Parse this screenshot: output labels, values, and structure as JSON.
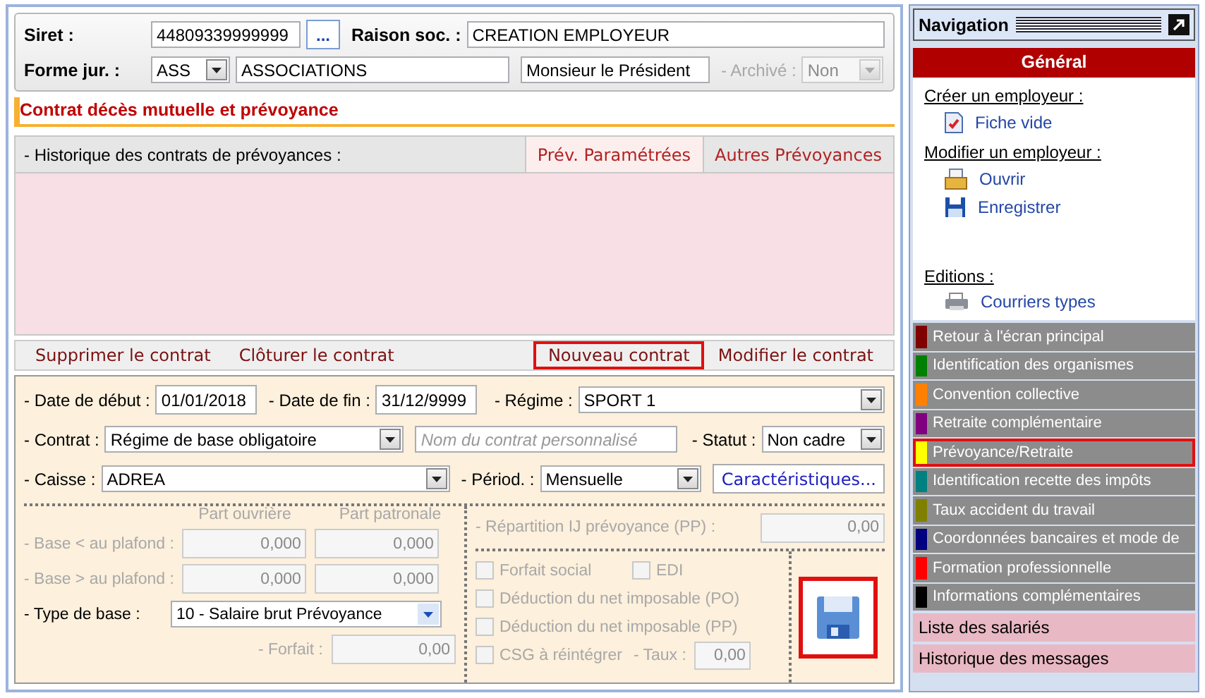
{
  "employer": {
    "siret_label": "Siret :",
    "siret": "44809339999999",
    "browse": "...",
    "name_label": "Raison soc. :",
    "name": "CREATION EMPLOYEUR",
    "form_label": "Forme jur. :",
    "form_code": "ASS",
    "form_name": "ASSOCIATIONS",
    "representative": "Monsieur le Président",
    "archive_label": "- Archivé :",
    "archive": "Non",
    "archive_disabled": true
  },
  "section_title": "Contrat décès mutuelle et prévoyance",
  "history": {
    "label": "- Historique des contrats de prévoyances :",
    "tabs": [
      {
        "label": "Prév. Paramétrées",
        "selected": true
      },
      {
        "label": "Autres Prévoyances",
        "selected": false
      }
    ]
  },
  "actions": [
    {
      "label": "Supprimer le contrat",
      "highlighted": false
    },
    {
      "label": "Clôturer le contrat",
      "highlighted": false
    },
    {
      "label": "Nouveau contrat",
      "highlighted": true
    },
    {
      "label": "Modifier le contrat",
      "highlighted": false
    }
  ],
  "contract": {
    "date_start": {
      "label": "- Date de début :",
      "value": "01/01/2018"
    },
    "date_end": {
      "label": "- Date de fin :",
      "value": "31/12/9999"
    },
    "regime": {
      "label": "- Régime :",
      "value": "SPORT 1"
    },
    "contract": {
      "label": "- Contrat :",
      "value": "Régime de base obligatoire"
    },
    "custom_name": {
      "placeholder": "Nom du contrat personnalisé"
    },
    "status": {
      "label": "- Statut :",
      "value": "Non cadre"
    },
    "fund": {
      "label": "- Caisse :",
      "value": "ADREA"
    },
    "period": {
      "label": "- Périod. :",
      "value": "Mensuelle"
    },
    "characteristics": "Caractéristiques..."
  },
  "bases": {
    "columns": [
      "Part ouvrière",
      "Part patronale"
    ],
    "rows": [
      {
        "label": "- Base < au plafond :",
        "values": [
          "0,000",
          "0,000"
        ],
        "disabled": true
      },
      {
        "label": "- Base > au plafond :",
        "values": [
          "0,000",
          "0,000"
        ],
        "disabled": true
      }
    ],
    "base_type": {
      "label": "- Type de base :",
      "value": "10 - Salaire brut Prévoyance",
      "disabled": false
    },
    "flat": {
      "label": "- Forfait :",
      "value": "0,00",
      "disabled": true
    }
  },
  "options": {
    "split": {
      "label": "- Répartition IJ prévoyance (PP) :",
      "value": "0,00",
      "disabled": true
    },
    "checkboxes": [
      {
        "label": "Forfait social",
        "checked": false,
        "disabled": true
      },
      {
        "label": "EDI",
        "checked": false,
        "disabled": true
      },
      {
        "label": "Déduction du net imposable (PO)",
        "checked": false,
        "disabled": true
      },
      {
        "label": "Déduction du net imposable (PP)",
        "checked": false,
        "disabled": true
      },
      {
        "label": "CSG à réintégrer",
        "checked": false,
        "disabled": true
      }
    ],
    "rate": {
      "label": "- Taux :",
      "value": "0,00",
      "disabled": true
    },
    "save_highlighted": true
  },
  "navigation": {
    "title": "Navigation",
    "header": "Général",
    "groups": [
      {
        "heading": "Créer un employeur :",
        "links": [
          {
            "label": "Fiche vide",
            "kind": "document"
          }
        ]
      },
      {
        "heading": "Modifier un employeur :",
        "links": [
          {
            "label": "Ouvrir",
            "kind": "open"
          },
          {
            "label": "Enregistrer",
            "kind": "save"
          }
        ]
      },
      {
        "heading": "Editions :",
        "links": [
          {
            "label": "Courriers types",
            "kind": "printer"
          }
        ]
      }
    ],
    "items": [
      {
        "label": "Retour à l'écran principal",
        "color": "#800000",
        "highlighted": false
      },
      {
        "label": "Identification des organismes",
        "color": "#008000",
        "highlighted": false
      },
      {
        "label": "Convention collective",
        "color": "#ff8000",
        "highlighted": false
      },
      {
        "label": "Retraite complémentaire",
        "color": "#800080",
        "highlighted": false
      },
      {
        "label": "Prévoyance/Retraite",
        "color": "#ffff00",
        "highlighted": true
      },
      {
        "label": "Identification recette des impôts",
        "color": "#008080",
        "highlighted": false
      },
      {
        "label": "Taux accident du travail",
        "color": "#808000",
        "highlighted": false
      },
      {
        "label": "Coordonnées bancaires et mode de",
        "color": "#000080",
        "highlighted": false
      },
      {
        "label": "Formation professionnelle",
        "color": "#ff0000",
        "highlighted": false
      },
      {
        "label": "Informations complémentaires",
        "color": "#000000",
        "highlighted": false
      }
    ],
    "lists": [
      "Liste des salariés",
      "Historique des messages"
    ]
  }
}
